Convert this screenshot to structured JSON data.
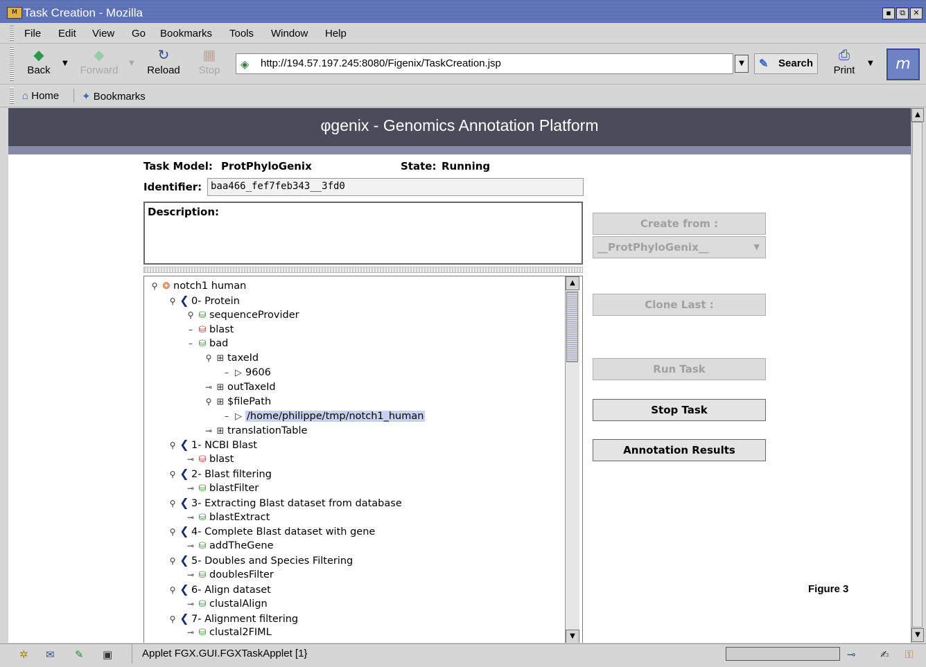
{
  "window": {
    "title": "Task Creation - Mozilla",
    "controls": [
      "▪",
      "⧉",
      "✕"
    ]
  },
  "menu": [
    "File",
    "Edit",
    "View",
    "Go",
    "Bookmarks",
    "Tools",
    "Window",
    "Help"
  ],
  "nav": {
    "back": "Back",
    "forward": "Forward",
    "reload": "Reload",
    "stop": "Stop",
    "search": "Search",
    "print": "Print",
    "url": "http://194.57.197.245:8080/Figenix/TaskCreation.jsp"
  },
  "personal_toolbar": {
    "home": "Home",
    "bookmarks": "Bookmarks"
  },
  "page": {
    "banner_symbol": "φ",
    "banner": "genix - Genomics Annotation Platform",
    "task_model_label": "Task Model:",
    "task_model": "ProtPhyloGenix",
    "state_label": "State:",
    "state": "Running",
    "identifier_label": "Identifier:",
    "identifier": "baa466_fef7feb343__3fd0",
    "description_label": "Description:",
    "create_from": "Create from :",
    "create_from_value": "__ProtPhyloGenix__",
    "clone_last": "Clone Last :",
    "run_task": "Run Task",
    "stop_task": "Stop Task",
    "annotation_results": "Annotation Results",
    "figure_label": "Figure 3"
  },
  "tree": [
    {
      "label": "notch1 human",
      "type": "root"
    },
    {
      "label": "0- Protein",
      "type": "step"
    },
    {
      "label": "sequenceProvider",
      "type": "prov"
    },
    {
      "label": "blast",
      "type": "prov-red"
    },
    {
      "label": "bad",
      "type": "prov"
    },
    {
      "label": "taxeId",
      "type": "param"
    },
    {
      "label": "9606",
      "type": "val"
    },
    {
      "label": "outTaxeId",
      "type": "param"
    },
    {
      "label": "$filePath",
      "type": "param"
    },
    {
      "label": "/home/philippe/tmp/notch1_human",
      "type": "val",
      "selected": true
    },
    {
      "label": "translationTable",
      "type": "param"
    },
    {
      "label": "1- NCBI Blast",
      "type": "step"
    },
    {
      "label": "blast",
      "type": "prov-red"
    },
    {
      "label": "2- Blast filtering",
      "type": "step"
    },
    {
      "label": "blastFilter",
      "type": "prov"
    },
    {
      "label": "3- Extracting Blast dataset from database",
      "type": "step"
    },
    {
      "label": "blastExtract",
      "type": "prov"
    },
    {
      "label": "4- Complete Blast dataset with gene",
      "type": "step"
    },
    {
      "label": "addTheGene",
      "type": "prov"
    },
    {
      "label": "5- Doubles and Species Filtering",
      "type": "step"
    },
    {
      "label": "doublesFilter",
      "type": "prov"
    },
    {
      "label": "6- Align dataset",
      "type": "step"
    },
    {
      "label": "clustalAlign",
      "type": "prov"
    },
    {
      "label": "7- Alignment filtering",
      "type": "step"
    },
    {
      "label": "clustal2FIML",
      "type": "prov"
    }
  ],
  "status": {
    "text": "Applet FGX.GUI.FGXTaskApplet [1}"
  }
}
